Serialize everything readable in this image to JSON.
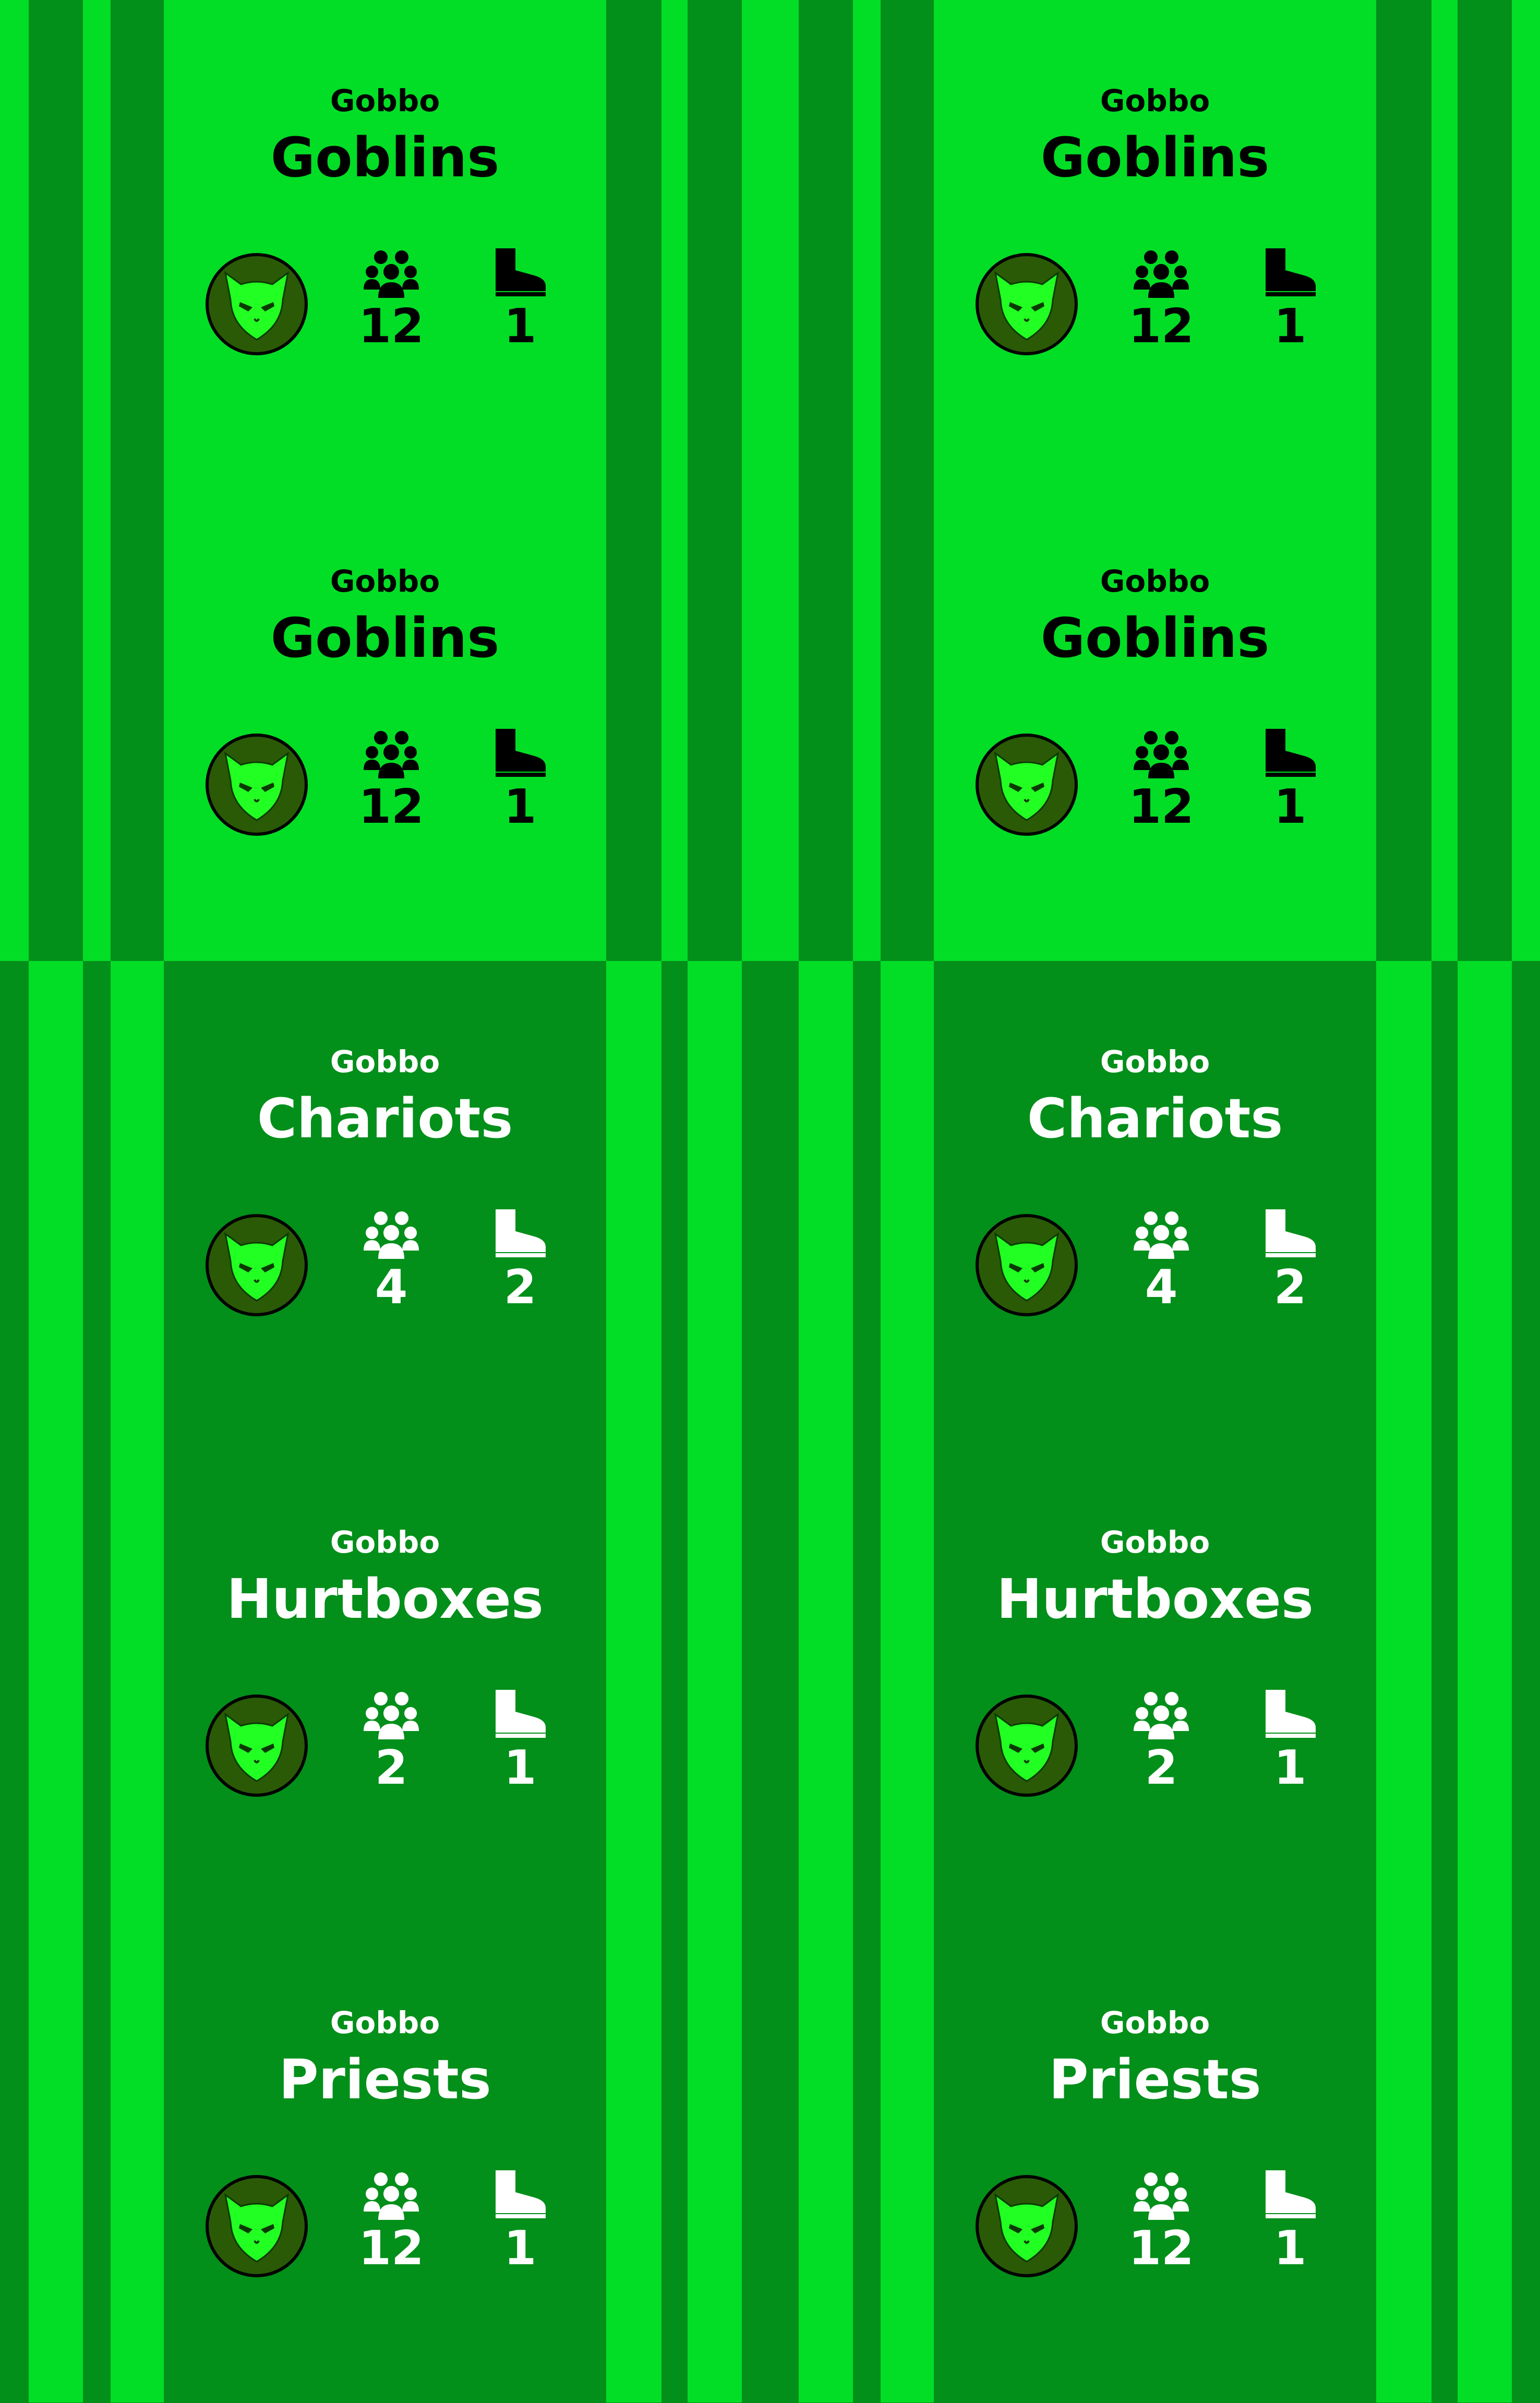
{
  "palette": {
    "bright_green": "#02de26",
    "dark_green": "#028f1a",
    "emblem_ring": "#2a5a06",
    "emblem_face": "#22ff22",
    "text_dark": "#000000",
    "text_light": "#ffffff"
  },
  "icons": {
    "emblem": "goblin-head-icon",
    "unit_count": "group-icon",
    "movement": "boot-icon"
  },
  "cards": [
    {
      "subtitle": "Gobbo",
      "title": "Goblins",
      "count": "12",
      "move": "1",
      "theme": "light"
    },
    {
      "subtitle": "Gobbo",
      "title": "Goblins",
      "count": "12",
      "move": "1",
      "theme": "light"
    },
    {
      "subtitle": "Gobbo",
      "title": "Goblins",
      "count": "12",
      "move": "1",
      "theme": "light"
    },
    {
      "subtitle": "Gobbo",
      "title": "Goblins",
      "count": "12",
      "move": "1",
      "theme": "light"
    },
    {
      "subtitle": "Gobbo",
      "title": "Chariots",
      "count": "4",
      "move": "2",
      "theme": "dark"
    },
    {
      "subtitle": "Gobbo",
      "title": "Chariots",
      "count": "4",
      "move": "2",
      "theme": "dark"
    },
    {
      "subtitle": "Gobbo",
      "title": "Hurtboxes",
      "count": "2",
      "move": "1",
      "theme": "dark"
    },
    {
      "subtitle": "Gobbo",
      "title": "Hurtboxes",
      "count": "2",
      "move": "1",
      "theme": "dark"
    },
    {
      "subtitle": "Gobbo",
      "title": "Priests",
      "count": "12",
      "move": "1",
      "theme": "dark"
    },
    {
      "subtitle": "Gobbo",
      "title": "Priests",
      "count": "12",
      "move": "1",
      "theme": "dark"
    }
  ]
}
